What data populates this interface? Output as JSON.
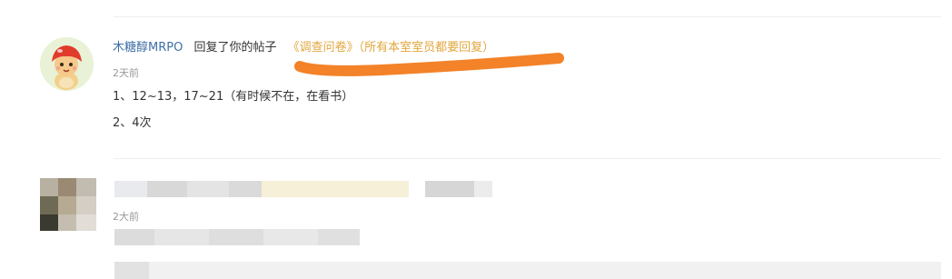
{
  "notifications": [
    {
      "username": "木糖醇MRPO",
      "action": "回复了你的帖子",
      "post_title": "《调查问卷》（所有本室室员都要回复）",
      "time": "2天前",
      "reply_lines": [
        "1、12~13，17~21（有时候不在，在看书）",
        "2、4次"
      ]
    },
    {
      "time": "2大前"
    }
  ],
  "colors": {
    "username": "#3f6fa5",
    "post_link": "#e1a63c",
    "highlight_stroke": "#f27b1c",
    "time": "#999999",
    "text": "#333333"
  },
  "icons": {
    "avatar": "cartoon-red-hat-character"
  }
}
